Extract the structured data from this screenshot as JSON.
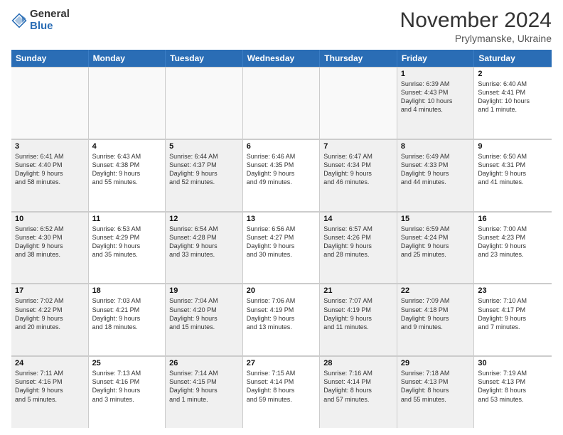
{
  "logo": {
    "general": "General",
    "blue": "Blue"
  },
  "header": {
    "month": "November 2024",
    "location": "Prylymanske, Ukraine"
  },
  "weekdays": [
    "Sunday",
    "Monday",
    "Tuesday",
    "Wednesday",
    "Thursday",
    "Friday",
    "Saturday"
  ],
  "rows": [
    {
      "cells": [
        {
          "day": "",
          "empty": true
        },
        {
          "day": "",
          "empty": true
        },
        {
          "day": "",
          "empty": true
        },
        {
          "day": "",
          "empty": true
        },
        {
          "day": "",
          "empty": true
        },
        {
          "day": "1",
          "info": "Sunrise: 6:39 AM\nSunset: 4:43 PM\nDaylight: 10 hours\nand 4 minutes.",
          "shaded": true
        },
        {
          "day": "2",
          "info": "Sunrise: 6:40 AM\nSunset: 4:41 PM\nDaylight: 10 hours\nand 1 minute.",
          "shaded": false
        }
      ]
    },
    {
      "cells": [
        {
          "day": "3",
          "info": "Sunrise: 6:41 AM\nSunset: 4:40 PM\nDaylight: 9 hours\nand 58 minutes.",
          "shaded": true
        },
        {
          "day": "4",
          "info": "Sunrise: 6:43 AM\nSunset: 4:38 PM\nDaylight: 9 hours\nand 55 minutes.",
          "shaded": false
        },
        {
          "day": "5",
          "info": "Sunrise: 6:44 AM\nSunset: 4:37 PM\nDaylight: 9 hours\nand 52 minutes.",
          "shaded": true
        },
        {
          "day": "6",
          "info": "Sunrise: 6:46 AM\nSunset: 4:35 PM\nDaylight: 9 hours\nand 49 minutes.",
          "shaded": false
        },
        {
          "day": "7",
          "info": "Sunrise: 6:47 AM\nSunset: 4:34 PM\nDaylight: 9 hours\nand 46 minutes.",
          "shaded": true
        },
        {
          "day": "8",
          "info": "Sunrise: 6:49 AM\nSunset: 4:33 PM\nDaylight: 9 hours\nand 44 minutes.",
          "shaded": true
        },
        {
          "day": "9",
          "info": "Sunrise: 6:50 AM\nSunset: 4:31 PM\nDaylight: 9 hours\nand 41 minutes.",
          "shaded": false
        }
      ]
    },
    {
      "cells": [
        {
          "day": "10",
          "info": "Sunrise: 6:52 AM\nSunset: 4:30 PM\nDaylight: 9 hours\nand 38 minutes.",
          "shaded": true
        },
        {
          "day": "11",
          "info": "Sunrise: 6:53 AM\nSunset: 4:29 PM\nDaylight: 9 hours\nand 35 minutes.",
          "shaded": false
        },
        {
          "day": "12",
          "info": "Sunrise: 6:54 AM\nSunset: 4:28 PM\nDaylight: 9 hours\nand 33 minutes.",
          "shaded": true
        },
        {
          "day": "13",
          "info": "Sunrise: 6:56 AM\nSunset: 4:27 PM\nDaylight: 9 hours\nand 30 minutes.",
          "shaded": false
        },
        {
          "day": "14",
          "info": "Sunrise: 6:57 AM\nSunset: 4:26 PM\nDaylight: 9 hours\nand 28 minutes.",
          "shaded": true
        },
        {
          "day": "15",
          "info": "Sunrise: 6:59 AM\nSunset: 4:24 PM\nDaylight: 9 hours\nand 25 minutes.",
          "shaded": true
        },
        {
          "day": "16",
          "info": "Sunrise: 7:00 AM\nSunset: 4:23 PM\nDaylight: 9 hours\nand 23 minutes.",
          "shaded": false
        }
      ]
    },
    {
      "cells": [
        {
          "day": "17",
          "info": "Sunrise: 7:02 AM\nSunset: 4:22 PM\nDaylight: 9 hours\nand 20 minutes.",
          "shaded": true
        },
        {
          "day": "18",
          "info": "Sunrise: 7:03 AM\nSunset: 4:21 PM\nDaylight: 9 hours\nand 18 minutes.",
          "shaded": false
        },
        {
          "day": "19",
          "info": "Sunrise: 7:04 AM\nSunset: 4:20 PM\nDaylight: 9 hours\nand 15 minutes.",
          "shaded": true
        },
        {
          "day": "20",
          "info": "Sunrise: 7:06 AM\nSunset: 4:19 PM\nDaylight: 9 hours\nand 13 minutes.",
          "shaded": false
        },
        {
          "day": "21",
          "info": "Sunrise: 7:07 AM\nSunset: 4:19 PM\nDaylight: 9 hours\nand 11 minutes.",
          "shaded": true
        },
        {
          "day": "22",
          "info": "Sunrise: 7:09 AM\nSunset: 4:18 PM\nDaylight: 9 hours\nand 9 minutes.",
          "shaded": true
        },
        {
          "day": "23",
          "info": "Sunrise: 7:10 AM\nSunset: 4:17 PM\nDaylight: 9 hours\nand 7 minutes.",
          "shaded": false
        }
      ]
    },
    {
      "cells": [
        {
          "day": "24",
          "info": "Sunrise: 7:11 AM\nSunset: 4:16 PM\nDaylight: 9 hours\nand 5 minutes.",
          "shaded": true
        },
        {
          "day": "25",
          "info": "Sunrise: 7:13 AM\nSunset: 4:16 PM\nDaylight: 9 hours\nand 3 minutes.",
          "shaded": false
        },
        {
          "day": "26",
          "info": "Sunrise: 7:14 AM\nSunset: 4:15 PM\nDaylight: 9 hours\nand 1 minute.",
          "shaded": true
        },
        {
          "day": "27",
          "info": "Sunrise: 7:15 AM\nSunset: 4:14 PM\nDaylight: 8 hours\nand 59 minutes.",
          "shaded": false
        },
        {
          "day": "28",
          "info": "Sunrise: 7:16 AM\nSunset: 4:14 PM\nDaylight: 8 hours\nand 57 minutes.",
          "shaded": true
        },
        {
          "day": "29",
          "info": "Sunrise: 7:18 AM\nSunset: 4:13 PM\nDaylight: 8 hours\nand 55 minutes.",
          "shaded": true
        },
        {
          "day": "30",
          "info": "Sunrise: 7:19 AM\nSunset: 4:13 PM\nDaylight: 8 hours\nand 53 minutes.",
          "shaded": false
        }
      ]
    }
  ]
}
